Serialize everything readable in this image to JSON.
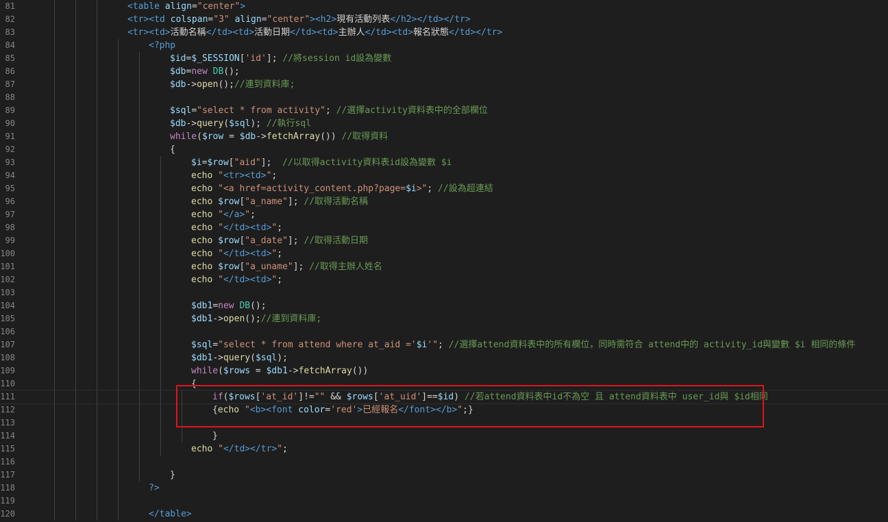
{
  "editor": {
    "lines": [
      {
        "n": "81",
        "indent": 4,
        "tokens": [
          [
            "tag",
            "<table "
          ],
          [
            "attr",
            "align"
          ],
          [
            "op",
            "="
          ],
          [
            "str",
            "\"center\""
          ],
          [
            "tag",
            ">"
          ]
        ]
      },
      {
        "n": "82",
        "indent": 4,
        "tokens": [
          [
            "tag",
            "<tr><td "
          ],
          [
            "attr",
            "colspan"
          ],
          [
            "op",
            "="
          ],
          [
            "str",
            "\"3\" "
          ],
          [
            "attr",
            "align"
          ],
          [
            "op",
            "="
          ],
          [
            "str",
            "\"center\""
          ],
          [
            "tag",
            ">"
          ],
          [
            "tag",
            "<h2>"
          ],
          [
            "plain",
            "現有活動列表"
          ],
          [
            "tag",
            "</h2></td></tr>"
          ]
        ]
      },
      {
        "n": "83",
        "indent": 4,
        "tokens": [
          [
            "tag",
            "<tr><td>"
          ],
          [
            "plain",
            "活動名稱"
          ],
          [
            "tag",
            "</td><td>"
          ],
          [
            "plain",
            "活動日期"
          ],
          [
            "tag",
            "</td><td>"
          ],
          [
            "plain",
            "主辦人"
          ],
          [
            "tag",
            "</td><td>"
          ],
          [
            "plain",
            "報名狀態"
          ],
          [
            "tag",
            "</td></tr>"
          ]
        ]
      },
      {
        "n": "84",
        "indent": 5,
        "tokens": [
          [
            "php",
            "<?php"
          ]
        ]
      },
      {
        "n": "85",
        "indent": 6,
        "tokens": [
          [
            "var",
            "$id"
          ],
          [
            "op",
            "="
          ],
          [
            "var",
            "$_SESSION"
          ],
          [
            "op",
            "["
          ],
          [
            "str",
            "'id'"
          ],
          [
            "op",
            "]; "
          ],
          [
            "cm",
            "//將session id設為變數"
          ]
        ]
      },
      {
        "n": "86",
        "indent": 6,
        "tokens": [
          [
            "var",
            "$db"
          ],
          [
            "op",
            "="
          ],
          [
            "kw",
            "new "
          ],
          [
            "cls",
            "DB"
          ],
          [
            "op",
            "();"
          ]
        ]
      },
      {
        "n": "87",
        "indent": 6,
        "tokens": [
          [
            "var",
            "$db"
          ],
          [
            "op",
            "->"
          ],
          [
            "fn",
            "open"
          ],
          [
            "op",
            "();"
          ],
          [
            "cm",
            "//連到資料庫;"
          ]
        ]
      },
      {
        "n": "88",
        "indent": 6,
        "tokens": []
      },
      {
        "n": "89",
        "indent": 6,
        "tokens": [
          [
            "var",
            "$sql"
          ],
          [
            "op",
            "="
          ],
          [
            "str",
            "\"select * from activity\""
          ],
          [
            "op",
            "; "
          ],
          [
            "cm",
            "//選擇activity資料表中的全部欄位"
          ]
        ]
      },
      {
        "n": "90",
        "indent": 6,
        "tokens": [
          [
            "var",
            "$db"
          ],
          [
            "op",
            "->"
          ],
          [
            "fn",
            "query"
          ],
          [
            "op",
            "("
          ],
          [
            "var",
            "$sql"
          ],
          [
            "op",
            "); "
          ],
          [
            "cm",
            "//執行sql"
          ]
        ]
      },
      {
        "n": "91",
        "indent": 6,
        "tokens": [
          [
            "kw",
            "while"
          ],
          [
            "op",
            "("
          ],
          [
            "var",
            "$row"
          ],
          [
            "op",
            " = "
          ],
          [
            "var",
            "$db"
          ],
          [
            "op",
            "->"
          ],
          [
            "fn",
            "fetchArray"
          ],
          [
            "op",
            "()) "
          ],
          [
            "cm",
            "//取得資料"
          ]
        ]
      },
      {
        "n": "92",
        "indent": 6,
        "tokens": [
          [
            "op",
            "{"
          ]
        ]
      },
      {
        "n": "93",
        "indent": 7,
        "tokens": [
          [
            "var",
            "$i"
          ],
          [
            "op",
            "="
          ],
          [
            "var",
            "$row"
          ],
          [
            "op",
            "["
          ],
          [
            "str",
            "\"aid\""
          ],
          [
            "op",
            "];  "
          ],
          [
            "cm",
            "//以取得activity資料表id設為變數 $i"
          ]
        ]
      },
      {
        "n": "94",
        "indent": 7,
        "tokens": [
          [
            "fn",
            "echo "
          ],
          [
            "str",
            "\""
          ],
          [
            "tag",
            "<tr><td>"
          ],
          [
            "str",
            "\""
          ],
          [
            "op",
            ";"
          ]
        ]
      },
      {
        "n": "95",
        "indent": 7,
        "tokens": [
          [
            "fn",
            "echo "
          ],
          [
            "str",
            "\"<a href=activity_content.php?page="
          ],
          [
            "var",
            "$i"
          ],
          [
            "str",
            ">\""
          ],
          [
            "op",
            "; "
          ],
          [
            "cm",
            "//設為超連結"
          ]
        ]
      },
      {
        "n": "96",
        "indent": 7,
        "tokens": [
          [
            "fn",
            "echo "
          ],
          [
            "var",
            "$row"
          ],
          [
            "op",
            "["
          ],
          [
            "str",
            "\"a_name\""
          ],
          [
            "op",
            "]; "
          ],
          [
            "cm",
            "//取得活動名稱"
          ]
        ]
      },
      {
        "n": "97",
        "indent": 7,
        "tokens": [
          [
            "fn",
            "echo "
          ],
          [
            "str",
            "\""
          ],
          [
            "tag",
            "</a>"
          ],
          [
            "str",
            "\""
          ],
          [
            "op",
            ";"
          ]
        ]
      },
      {
        "n": "98",
        "indent": 7,
        "tokens": [
          [
            "fn",
            "echo "
          ],
          [
            "str",
            "\""
          ],
          [
            "tag",
            "</td><td>"
          ],
          [
            "str",
            "\""
          ],
          [
            "op",
            ";"
          ]
        ]
      },
      {
        "n": "99",
        "indent": 7,
        "tokens": [
          [
            "fn",
            "echo "
          ],
          [
            "var",
            "$row"
          ],
          [
            "op",
            "["
          ],
          [
            "str",
            "\"a_date\""
          ],
          [
            "op",
            "]; "
          ],
          [
            "cm",
            "//取得活動日期"
          ]
        ]
      },
      {
        "n": "100",
        "indent": 7,
        "tokens": [
          [
            "fn",
            "echo "
          ],
          [
            "str",
            "\""
          ],
          [
            "tag",
            "</td><td>"
          ],
          [
            "str",
            "\""
          ],
          [
            "op",
            ";"
          ]
        ]
      },
      {
        "n": "101",
        "indent": 7,
        "tokens": [
          [
            "fn",
            "echo "
          ],
          [
            "var",
            "$row"
          ],
          [
            "op",
            "["
          ],
          [
            "str",
            "\"a_uname\""
          ],
          [
            "op",
            "]; "
          ],
          [
            "cm",
            "//取得主辦人姓名"
          ]
        ]
      },
      {
        "n": "102",
        "indent": 7,
        "tokens": [
          [
            "fn",
            "echo "
          ],
          [
            "str",
            "\""
          ],
          [
            "tag",
            "</td><td>"
          ],
          [
            "str",
            "\""
          ],
          [
            "op",
            ";"
          ]
        ]
      },
      {
        "n": "103",
        "indent": 7,
        "tokens": []
      },
      {
        "n": "104",
        "indent": 7,
        "tokens": [
          [
            "var",
            "$db1"
          ],
          [
            "op",
            "="
          ],
          [
            "kw",
            "new "
          ],
          [
            "cls",
            "DB"
          ],
          [
            "op",
            "();"
          ]
        ]
      },
      {
        "n": "105",
        "indent": 7,
        "tokens": [
          [
            "var",
            "$db1"
          ],
          [
            "op",
            "->"
          ],
          [
            "fn",
            "open"
          ],
          [
            "op",
            "();"
          ],
          [
            "cm",
            "//連到資料庫;"
          ]
        ]
      },
      {
        "n": "106",
        "indent": 7,
        "tokens": []
      },
      {
        "n": "107",
        "indent": 7,
        "tokens": [
          [
            "var",
            "$sql"
          ],
          [
            "op",
            "="
          ],
          [
            "str",
            "\"select * from attend where at_aid ='"
          ],
          [
            "var",
            "$i"
          ],
          [
            "str",
            "'\""
          ],
          [
            "op",
            "; "
          ],
          [
            "cm",
            "//選擇attend資料表中的所有欄位，同時需符合 attend中的 activity_id與變數 $i 相同的條件"
          ]
        ]
      },
      {
        "n": "108",
        "indent": 7,
        "tokens": [
          [
            "var",
            "$db1"
          ],
          [
            "op",
            "->"
          ],
          [
            "fn",
            "query"
          ],
          [
            "op",
            "("
          ],
          [
            "var",
            "$sql"
          ],
          [
            "op",
            ");"
          ]
        ]
      },
      {
        "n": "109",
        "indent": 7,
        "tokens": [
          [
            "kw",
            "while"
          ],
          [
            "op",
            "("
          ],
          [
            "var",
            "$rows"
          ],
          [
            "op",
            " = "
          ],
          [
            "var",
            "$db1"
          ],
          [
            "op",
            "->"
          ],
          [
            "fn",
            "fetchArray"
          ],
          [
            "op",
            "())"
          ]
        ]
      },
      {
        "n": "110",
        "indent": 7,
        "tokens": [
          [
            "op",
            "{"
          ]
        ]
      },
      {
        "n": "111",
        "indent": 8,
        "tokens": [
          [
            "kw",
            "if"
          ],
          [
            "op",
            "("
          ],
          [
            "var",
            "$rows"
          ],
          [
            "op",
            "["
          ],
          [
            "str",
            "'at_id'"
          ],
          [
            "op",
            "]!="
          ],
          [
            "str",
            "\"\""
          ],
          [
            "op",
            " && "
          ],
          [
            "var",
            "$rows"
          ],
          [
            "op",
            "["
          ],
          [
            "str",
            "'at_uid'"
          ],
          [
            "op",
            "]=="
          ],
          [
            "var",
            "$id"
          ],
          [
            "op",
            ") "
          ],
          [
            "cm",
            "//若attend資料表中id不為空 且 attend資料表中 user_id與 $id相同"
          ]
        ]
      },
      {
        "n": "112",
        "indent": 8,
        "tokens": [
          [
            "op",
            "{"
          ],
          [
            "fn",
            "echo "
          ],
          [
            "str",
            "\""
          ],
          [
            "tag",
            "<b><font "
          ],
          [
            "attr",
            "color"
          ],
          [
            "op",
            "="
          ],
          [
            "str",
            "'red'"
          ],
          [
            "tag",
            ">"
          ],
          [
            "str",
            "已經報名"
          ],
          [
            "tag",
            "</font></b>"
          ],
          [
            "str",
            "\""
          ],
          [
            "op",
            ";}"
          ]
        ]
      },
      {
        "n": "113",
        "indent": 8,
        "tokens": []
      },
      {
        "n": "114",
        "indent": 8,
        "tokens": [
          [
            "op",
            "}"
          ]
        ]
      },
      {
        "n": "115",
        "indent": 7,
        "tokens": [
          [
            "fn",
            "echo "
          ],
          [
            "str",
            "\""
          ],
          [
            "tag",
            "</td></tr>"
          ],
          [
            "str",
            "\""
          ],
          [
            "op",
            ";"
          ]
        ]
      },
      {
        "n": "116",
        "indent": 6,
        "tokens": []
      },
      {
        "n": "117",
        "indent": 6,
        "tokens": [
          [
            "op",
            "}"
          ]
        ]
      },
      {
        "n": "118",
        "indent": 5,
        "tokens": [
          [
            "php",
            "?>"
          ]
        ]
      },
      {
        "n": "119",
        "indent": 5,
        "tokens": []
      },
      {
        "n": "120",
        "indent": 5,
        "tokens": [
          [
            "tag",
            "</table>"
          ]
        ]
      }
    ]
  }
}
